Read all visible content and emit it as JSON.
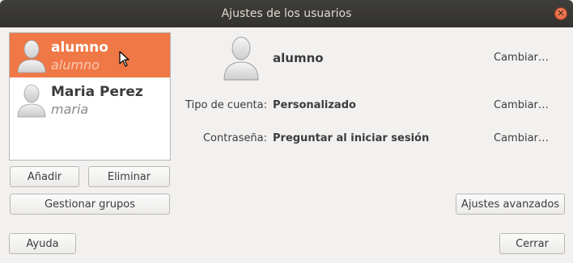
{
  "window": {
    "title": "Ajustes de los usuarios"
  },
  "users": [
    {
      "name": "alumno",
      "login": "alumno",
      "selected": true
    },
    {
      "name": "Maria Perez",
      "login": "maria",
      "selected": false
    }
  ],
  "list_buttons": {
    "add": "Añadir",
    "remove": "Eliminar",
    "groups": "Gestionar grupos"
  },
  "detail": {
    "name": "alumno",
    "name_change": "Cambiar…",
    "account_type_label": "Tipo de cuenta:",
    "account_type_value": "Personalizado",
    "account_type_change": "Cambiar…",
    "password_label": "Contraseña:",
    "password_value": "Preguntar al iniciar sesión",
    "password_change": "Cambiar…",
    "advanced": "Ajustes avanzados"
  },
  "footer": {
    "help": "Ayuda",
    "close": "Cerrar"
  },
  "colors": {
    "selection": "#f07746",
    "titlebar": "#3c3b37",
    "close_button": "#e95420"
  }
}
